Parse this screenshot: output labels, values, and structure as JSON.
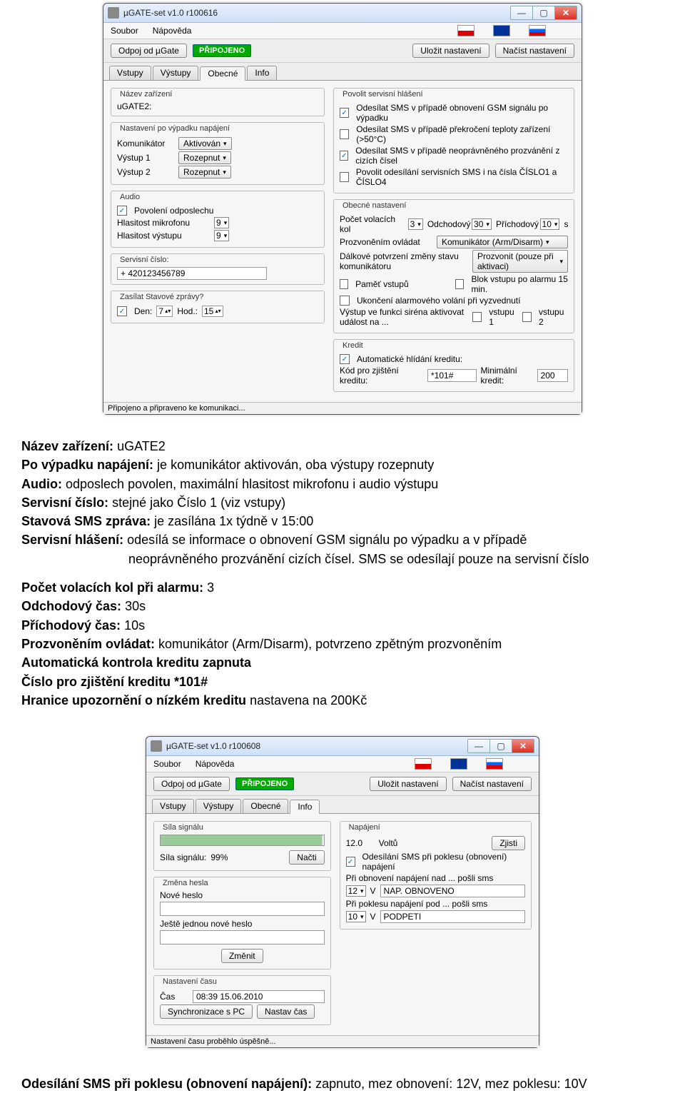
{
  "win1": {
    "title": "µGATE-set v1.0 r100616",
    "menu": {
      "file": "Soubor",
      "help": "Nápověda"
    },
    "toolbar": {
      "disconnect": "Odpoj od µGate",
      "status": "PŘIPOJENO",
      "save": "Uložit nastavení",
      "load": "Načíst nastavení"
    },
    "tabs": [
      "Vstupy",
      "Výstupy",
      "Obecné",
      "Info"
    ],
    "activeTab": "Obecné",
    "left": {
      "devicename_label": "Název zařízení",
      "devicename": "uGATE2:",
      "after_power_label": "Nastavení po výpadku napájení",
      "communicator_label": "Komunikátor",
      "communicator_value": "Aktivován",
      "out1_label": "Výstup 1",
      "out1_value": "Rozepnut",
      "out2_label": "Výstup 2",
      "out2_value": "Rozepnut",
      "audio_label": "Audio",
      "listen_label": "Povolení odposlechu",
      "mic_label": "Hlasitost mikrofonu",
      "mic_value": "9",
      "outg_label": "Hlasitost výstupu",
      "outg_value": "9",
      "service_label": "Servisní číslo:",
      "service_value": "+   420123456789",
      "status_msg_label": "Zasílat Stavové zprávy?",
      "day_label": "Den:",
      "day_value": "7",
      "hour_label": "Hod.:",
      "hour_value": "15"
    },
    "right": {
      "svc_report_label": "Povolit servisní hlášení",
      "svc_sms1": "Odesílat SMS v případě obnovení GSM signálu po výpadku",
      "svc_sms2": "Odesílat SMS v případě překročení teploty zařízení (>50°C)",
      "svc_sms3": "Odesílat SMS v případě neoprávněného prozvánění z cizích čísel",
      "svc_sms4": "Povolit odesílání servisních SMS i na čísla ČÍSLO1 a ČÍSLO4",
      "general_label": "Obecné nastavení",
      "ringcount_label": "Počet volacích kol",
      "ringcount_value": "3",
      "leave_label": "Odchodový",
      "leave_value": "30",
      "arrive_label": "Příchodový",
      "arrive_value": "10",
      "sec_unit": "s",
      "ringctrl_label": "Prozvoněním ovládat",
      "ringctrl_value": "Komunikátor (Arm/Disarm)",
      "remoteconf_label": "Dálkové potvrzení změny stavu komunikátoru",
      "remoteconf_value": "Prozvonit (pouze při aktivaci)",
      "inmem_label": "Paměť vstupů",
      "block15_label": "Blok vstupu po alarmu 15 min.",
      "endcall_label": "Ukončení alarmového volání při vyzvednutí",
      "siren_label": "Výstup ve funkci siréna aktivovat událost na ...",
      "in1_label": "vstupu 1",
      "in2_label": "vstupu 2",
      "credit_label": "Kredit",
      "autowatch_label": "Automatické hlídání kreditu:",
      "creditcode_label": "Kód pro zjištění kreditu:",
      "creditcode_value": "*101#",
      "mincredit_label": "Minimální kredit:",
      "mincredit_value": "200"
    },
    "statusbar": "Připojeno a připraveno ke komunikaci..."
  },
  "article1": {
    "l1a": "Název zařízení:",
    "l1b": "uGATE2",
    "l2a": "Po výpadku napájení:",
    "l2b": "je komunikátor aktivován, oba výstupy rozepnuty",
    "l3a": "Audio:",
    "l3b": "odposlech povolen, maximální hlasitost mikrofonu i audio výstupu",
    "l4a": "Servisní číslo:",
    "l4b": "stejné jako Číslo 1 (viz vstupy)",
    "l5a": "Stavová SMS zpráva:",
    "l5b": "je zasílána 1x týdně v 15:00",
    "l6a": "Servisní hlášení:",
    "l6b": "odesílá se informace o obnovení GSM signálu po výpadku a v případě",
    "l6c": "neoprávněného prozvánění cizích čísel. SMS se odesílají pouze na servisní číslo",
    "l7a": "Počet volacích kol při alarmu:",
    "l7b": "3",
    "l8a": "Odchodový čas:",
    "l8b": "30s",
    "l9a": "Příchodový čas:",
    "l9b": "10s",
    "l10a": "Prozvoněním ovládat:",
    "l10b": "komunikátor (Arm/Disarm), potvrzeno zpětným prozvoněním",
    "l11": "Automatická kontrola kreditu zapnuta",
    "l12": "Číslo pro zjištění kreditu *101#",
    "l13a": "Hranice upozornění o nízkém kreditu",
    "l13b": "nastavena na 200Kč"
  },
  "win2": {
    "title": "µGATE-set v1.0 r100608",
    "menu": {
      "file": "Soubor",
      "help": "Nápověda"
    },
    "toolbar": {
      "disconnect": "Odpoj od µGate",
      "status": "PŘIPOJENO",
      "save": "Uložit nastavení",
      "load": "Načíst nastavení"
    },
    "tabs": [
      "Vstupy",
      "Výstupy",
      "Obecné",
      "Info"
    ],
    "activeTab": "Info",
    "signal_group": "Síla signálu",
    "signal_label": "Síla signálu:",
    "signal_value": "99%",
    "signal_btn": "Načti",
    "pwd_group": "Změna hesla",
    "pwd_new": "Nové heslo",
    "pwd_again": "Ještě jednou nové heslo",
    "pwd_btn": "Změnit",
    "time_group": "Nastavení času",
    "time_label": "Čas",
    "time_value": "08:39 15.06.2010",
    "time_sync": "Synchronizace s PC",
    "time_set": "Nastav čas",
    "power_group": "Napájení",
    "voltage": "12.0",
    "voltage_unit": "Voltů",
    "power_btn": "Zjisti",
    "sms_on_drop": "Odesílání SMS při poklesu (obnovení) napájení",
    "restore_label": "Při obnovení napájení nad ... pošli sms",
    "restore_v": "12",
    "restore_unit": "V",
    "restore_text": "NAP. OBNOVENO",
    "drop_label": "Při poklesu napájení pod ... pošli sms",
    "drop_v": "10",
    "drop_unit": "V",
    "drop_text": "PODPETI",
    "statusbar": "Nastavení času proběhlo úspěšně..."
  },
  "article2": {
    "la": "Odesílání SMS při poklesu (obnovení napájení):",
    "lb": "zapnuto, mez obnovení: 12V, mez poklesu: 10V"
  }
}
